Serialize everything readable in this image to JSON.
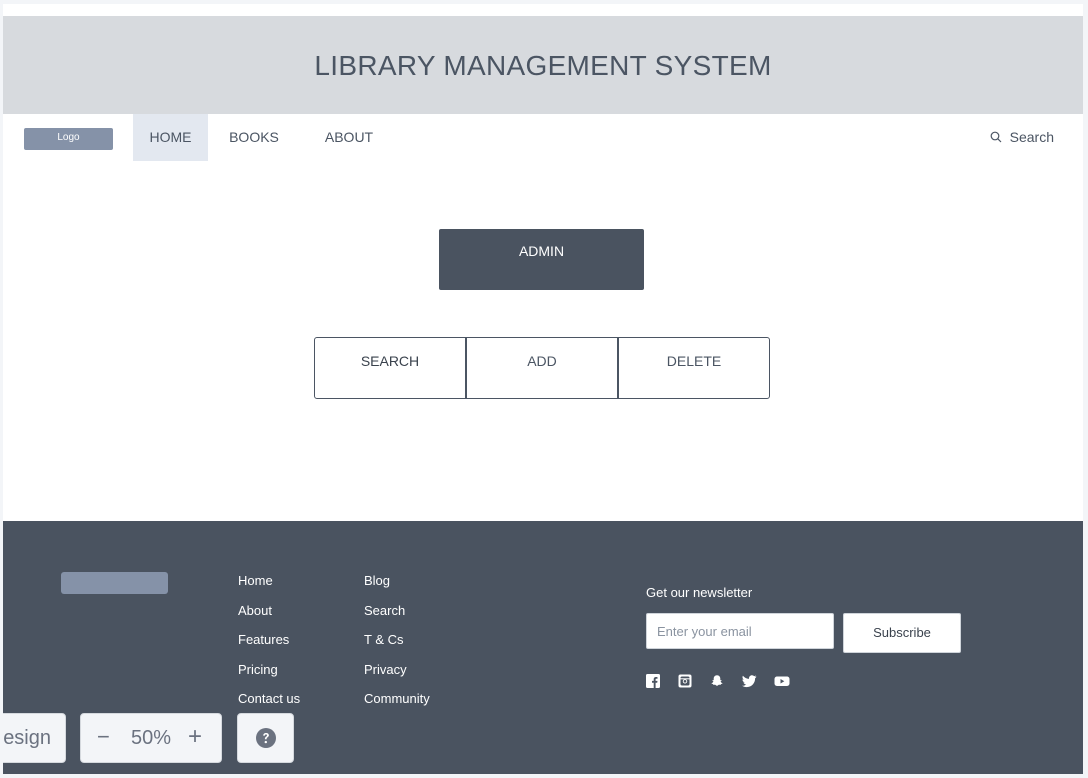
{
  "header": {
    "title": "LIBRARY MANAGEMENT SYSTEM"
  },
  "nav": {
    "logo_label": "Logo",
    "items": [
      {
        "label": "HOME",
        "active": true
      },
      {
        "label": "BOOKS",
        "active": false
      },
      {
        "label": "ABOUT",
        "active": false
      }
    ],
    "search_label": "Search",
    "search_icon": "search-icon"
  },
  "main": {
    "admin_label": "ADMIN",
    "actions": [
      {
        "label": "SEARCH"
      },
      {
        "label": "ADD"
      },
      {
        "label": "DELETE"
      }
    ]
  },
  "footer": {
    "links_col1": [
      "Home",
      "About",
      "Features",
      "Pricing",
      "Contact us"
    ],
    "links_col2": [
      "Blog",
      "Search",
      "T & Cs",
      "Privacy",
      "Community"
    ],
    "newsletter_label": "Get our newsletter",
    "email_placeholder": "Enter your email",
    "subscribe_label": "Subscribe",
    "social_icons": [
      "facebook-icon",
      "instagram-icon",
      "snapchat-icon",
      "twitter-icon",
      "youtube-icon"
    ]
  },
  "toolbar": {
    "mode_label": "esign",
    "zoom_out": "−",
    "zoom_value": "50%",
    "zoom_in": "+",
    "help_icon": "help-icon"
  },
  "colors": {
    "header_bg": "#d7dade",
    "dark": "#4a5360",
    "logo_block": "#8592a8",
    "nav_active": "#e3e8f0"
  }
}
